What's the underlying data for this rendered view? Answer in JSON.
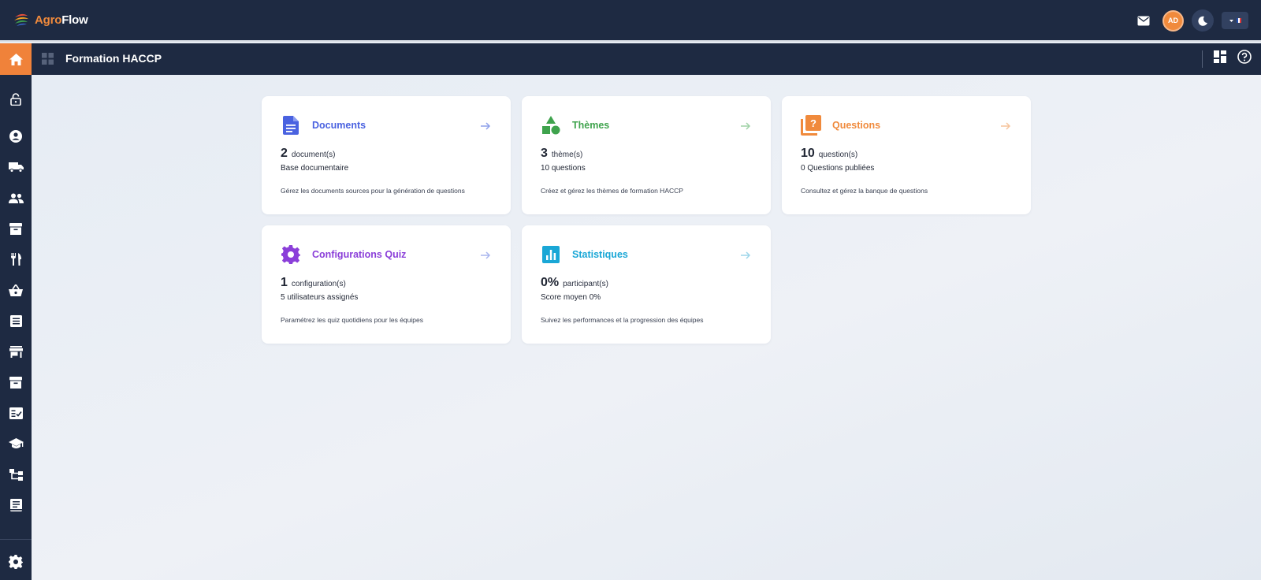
{
  "app": {
    "brand_part1": "Agro",
    "brand_part2": "Flow"
  },
  "header": {
    "avatar_initials": "AD",
    "language": "FR"
  },
  "subheader": {
    "title": "Formation HACCP"
  },
  "sidebar": {
    "items": [
      "lock-icon",
      "account-icon",
      "truck-icon",
      "people-icon",
      "archive-icon",
      "utensils-icon",
      "basket-icon",
      "list-icon",
      "store-icon",
      "archive-icon",
      "checklist-icon",
      "school-icon",
      "hierarchy-icon",
      "receipt-icon"
    ],
    "settings": "gear-icon"
  },
  "colors": {
    "topbar": "#1e2a42",
    "accent": "#f0823a",
    "documents": "#4a62e0",
    "themes": "#3fa34d",
    "questions": "#f08a3c",
    "config": "#8b3fd9",
    "stats": "#1aa7d6"
  },
  "cards": [
    {
      "title": "Documents",
      "count": "2",
      "unit": "document(s)",
      "sub": "Base documentaire",
      "desc": "Gérez les documents sources pour la génération de questions"
    },
    {
      "title": "Thèmes",
      "count": "3",
      "unit": "thème(s)",
      "sub": "10 questions",
      "desc": "Créez et gérez les thèmes de formation HACCP"
    },
    {
      "title": "Questions",
      "count": "10",
      "unit": "question(s)",
      "sub": "0 Questions publiées",
      "desc": "Consultez et gérez la banque de questions"
    },
    {
      "title": "Configurations Quiz",
      "count": "1",
      "unit": "configuration(s)",
      "sub": "5 utilisateurs assignés",
      "desc": "Paramétrez les quiz quotidiens pour les équipes"
    },
    {
      "title": "Statistiques",
      "count": "0%",
      "unit": "participant(s)",
      "sub": "Score moyen 0%",
      "desc": "Suivez les performances et la progression des équipes"
    }
  ]
}
